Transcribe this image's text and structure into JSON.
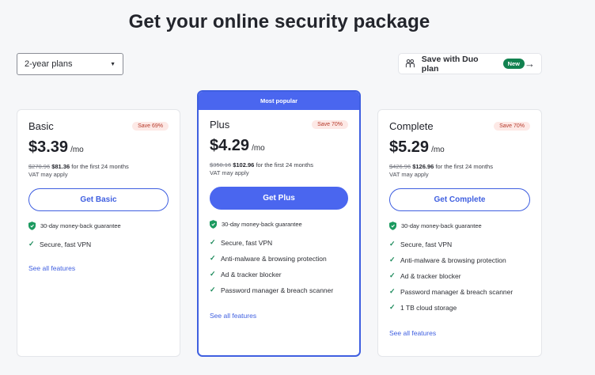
{
  "header": {
    "title": "Get your online security package"
  },
  "plan_select": {
    "value": "2-year plans",
    "caret_icon": "caret-down-icon"
  },
  "duo": {
    "label": "Save with Duo plan",
    "badge": "New",
    "arrow": "→"
  },
  "plans": [
    {
      "name": "Basic",
      "save": "Save 69%",
      "price": "$3.39",
      "per": "/mo",
      "old_price": "$270.96",
      "new_price": "$81.36",
      "term": "for the first 24 months",
      "vat": "VAT may apply",
      "button": "Get Basic",
      "guarantee": "30-day money-back guarantee",
      "features": [
        "Secure, fast VPN"
      ],
      "see_all": "See all features"
    },
    {
      "banner": "Most popular",
      "name": "Plus",
      "save": "Save 70%",
      "price": "$4.29",
      "per": "/mo",
      "old_price": "$350.16",
      "new_price": "$102.96",
      "term": "for the first 24 months",
      "vat": "VAT may apply",
      "button": "Get Plus",
      "guarantee": "30-day money-back guarantee",
      "features": [
        "Secure, fast VPN",
        "Anti-malware & browsing protection",
        "Ad & tracker blocker",
        "Password manager & breach scanner"
      ],
      "see_all": "See all features"
    },
    {
      "name": "Complete",
      "save": "Save 70%",
      "price": "$5.29",
      "per": "/mo",
      "old_price": "$426.96",
      "new_price": "$126.96",
      "term": "for the first 24 months",
      "vat": "VAT may apply",
      "button": "Get Complete",
      "guarantee": "30-day money-back guarantee",
      "features": [
        "Secure, fast VPN",
        "Anti-malware & browsing protection",
        "Ad & tracker blocker",
        "Password manager & breach scanner",
        "1 TB cloud storage"
      ],
      "see_all": "See all features"
    }
  ],
  "colors": {
    "accent": "#4a66ef",
    "check": "#1b8a5a",
    "badge_bg": "#fde9e6",
    "badge_text": "#b63a2b",
    "new_badge": "#128250"
  }
}
